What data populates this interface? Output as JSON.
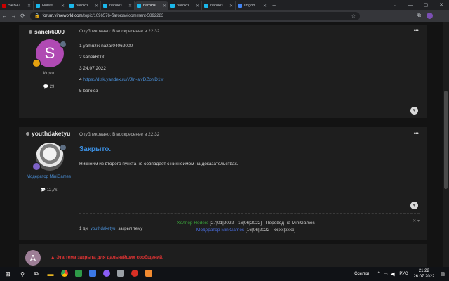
{
  "browser": {
    "tabs": [
      {
        "label": "SABATON - Ho…",
        "color": "#cc0000",
        "active": false
      },
      {
        "label": "Новая тема - V…",
        "color": "#1ab7ea",
        "active": false
      },
      {
        "label": "багоюз - Жало…",
        "color": "#1ab7ea",
        "active": false
      },
      {
        "label": "багоюз - Жало…",
        "color": "#1ab7ea",
        "active": false
      },
      {
        "label": "багоюз - Жало…",
        "color": "#1ab7ea",
        "active": true
      },
      {
        "label": "багоюз - Жало…",
        "color": "#1ab7ea",
        "active": false
      },
      {
        "label": "багоюз - Жало…",
        "color": "#1ab7ea",
        "active": false
      },
      {
        "label": "Img88 — Загру…",
        "color": "#4285f4",
        "active": false
      }
    ],
    "url_host": "forum.vimeworld.com",
    "url_path": "/topic/1096576-багоюз/#comment-5892283"
  },
  "post1": {
    "username": "sanek6000",
    "posted": "Опубликовано: В воскресенье в 22:32",
    "avatar_letter": "S",
    "avatar_color": "#b04ab3",
    "role": "Игрок",
    "rep": "29",
    "lines": [
      "1 yamuzik nazar04062000",
      "2 sanek6000",
      "3 24.07.2022",
      "4 ",
      "5 багоюз"
    ],
    "link": "https://disk.yandex.ru/i/Jln-alvDZoYD1w"
  },
  "post2": {
    "username": "youthdaketyu",
    "posted": "Опубликовано: В воскресенье в 22:32",
    "role": "Модератор MiniGames",
    "rep": "12,7k",
    "title": "Закрыто.",
    "body": "Никнейм из второго пункта не совпадает с никнеймом на доказательствах.",
    "sig1_role": "Хелпер Hoderc",
    "sig1_rest": " [27|01|2022 - 16|06|2022] - Перевод на MiniGames",
    "sig2_role": "Модератор MiniGames",
    "sig2_rest": " [16|06|2022 - xx|xx|xxxx]"
  },
  "event": {
    "days": "1 дн",
    "user": "youthdaketyu",
    "action": "закрыл тему"
  },
  "closed": {
    "avatar_letter": "A",
    "text": "Эта тема закрыта для дальнейших сообщений."
  },
  "taskbar": {
    "links": "Ссылки",
    "lang": "РУС",
    "time": "21:22",
    "date": "26.07.2022"
  }
}
